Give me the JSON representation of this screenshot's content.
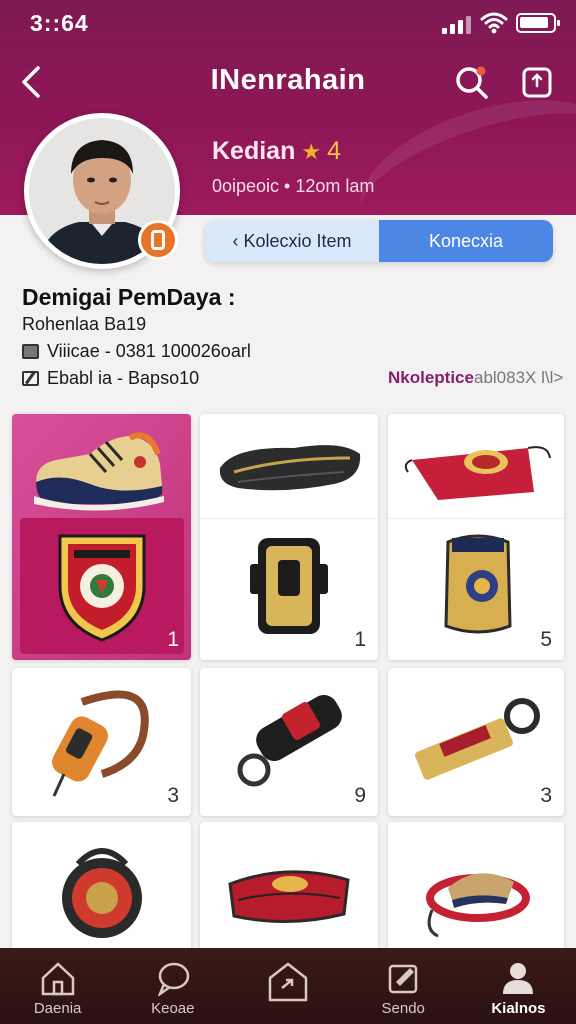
{
  "status_bar": {
    "time": "3::64"
  },
  "nav": {
    "title": "INenrahain"
  },
  "profile": {
    "name": "Kedian",
    "rating": "4",
    "meta": "0oipeoic • 12om lam"
  },
  "segment": {
    "left_label": "‹ Kolecxio Item",
    "right_label": "Konecxia"
  },
  "info": {
    "title": "Demigai PemDaya :",
    "line1": "Rohenlaa Ba19",
    "line2": "Viiicae - 0381 100026oarl",
    "line3": "Ebabl ia - Bapso10",
    "collection_accent": "Nkolepticе",
    "collection_rest": "abl083X l\\l>"
  },
  "grid_items": [
    {
      "name": "sneaker-and-crest",
      "count": "1"
    },
    {
      "name": "pouch-and-holster",
      "count": "1"
    },
    {
      "name": "red-bag-and-vest",
      "count": "5"
    },
    {
      "name": "strap-device",
      "count": "3"
    },
    {
      "name": "keychain-cylinder",
      "count": "9"
    },
    {
      "name": "bottle-opener",
      "count": "3"
    },
    {
      "name": "round-device",
      "count": ""
    },
    {
      "name": "red-case",
      "count": ""
    },
    {
      "name": "shoe-clip",
      "count": ""
    }
  ],
  "tabs": [
    {
      "label": "Daenia",
      "icon": "home-icon"
    },
    {
      "label": "Keoae",
      "icon": "chat-icon"
    },
    {
      "label": "",
      "icon": "house-arrow-icon"
    },
    {
      "label": "Sendo",
      "icon": "note-icon"
    },
    {
      "label": "Kialnos",
      "icon": "user-icon"
    }
  ],
  "colors": {
    "header": "#8e1656",
    "accent_blue": "#4d87e6",
    "tab_bar": "#2f1513",
    "star": "#f2b02c"
  }
}
